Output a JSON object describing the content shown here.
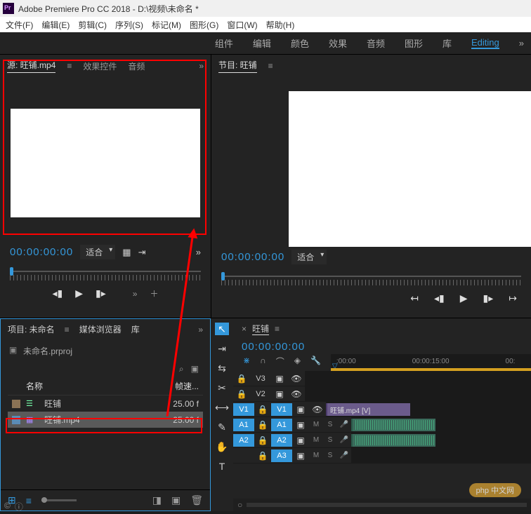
{
  "title": "Adobe Premiere Pro CC 2018 - D:\\视频\\未命名 *",
  "menubar": [
    "文件(F)",
    "编辑(E)",
    "剪辑(C)",
    "序列(S)",
    "标记(M)",
    "图形(G)",
    "窗口(W)",
    "帮助(H)"
  ],
  "workspaces": [
    "组件",
    "编辑",
    "颜色",
    "效果",
    "音频",
    "图形",
    "库",
    "Editing"
  ],
  "workspace_active": "Editing",
  "source": {
    "tabs": [
      "源: 旺铺.mp4",
      "效果控件",
      "音频"
    ],
    "active_tab": "源: 旺铺.mp4",
    "timecode": "00:00:00:00",
    "fit": "适合"
  },
  "program": {
    "title": "节目: 旺铺",
    "timecode": "00:00:00:00",
    "fit": "适合"
  },
  "project": {
    "tabs": [
      "项目: 未命名",
      "媒体浏览器",
      "库"
    ],
    "active_tab": "项目: 未命名",
    "filename": "未命名.prproj",
    "cols": {
      "name": "名称",
      "fps": "帧速..."
    },
    "rows": [
      {
        "name": "旺铺",
        "fps": "25.00 f",
        "type": "sequence"
      },
      {
        "name": "旺铺.mp4",
        "fps": "25.00 f",
        "type": "video",
        "selected": true
      }
    ]
  },
  "timeline": {
    "title": "旺铺",
    "timecode": "00:00:00:00",
    "ruler": [
      ":00:00",
      "00:00:15:00",
      "00:"
    ],
    "video_tracks": [
      {
        "label": "V3",
        "active": false
      },
      {
        "label": "V2",
        "active": false
      },
      {
        "label": "V1",
        "active": true,
        "clip": "旺铺.mp4 [V]"
      }
    ],
    "audio_tracks": [
      {
        "label": "A1",
        "active": true,
        "src": "A1",
        "clip": true
      },
      {
        "label": "A2",
        "active": true,
        "src": "A2",
        "clip": true
      },
      {
        "label": "A3",
        "active": true,
        "src": "A3"
      }
    ]
  },
  "watermark": "php 中文网"
}
